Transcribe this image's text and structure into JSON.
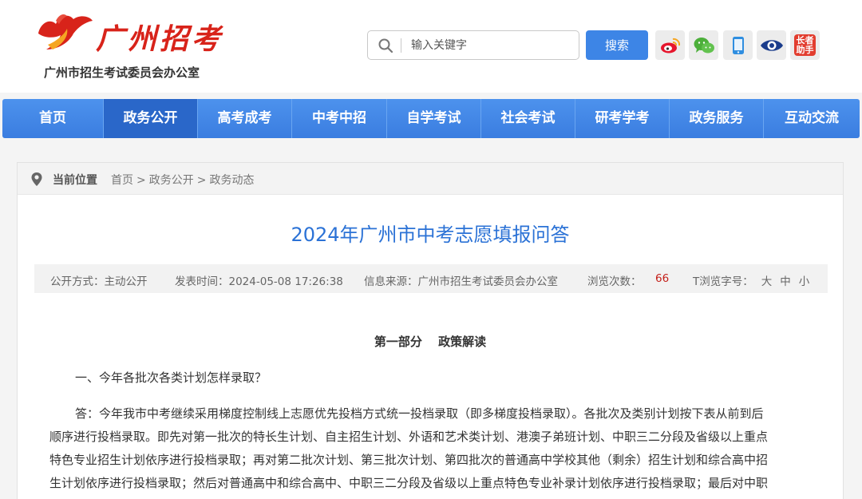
{
  "header": {
    "logo_title": "广州招考",
    "logo_subtitle": "广州市招生考试委员会办公室",
    "search_placeholder": "输入关键字",
    "search_button": "搜索",
    "social_icons": [
      "weibo-icon",
      "wechat-icon",
      "mobile-icon",
      "eye-icon",
      "elder-assistant-icon"
    ],
    "elder_label_line1": "长者",
    "elder_label_line2": "助手"
  },
  "nav": {
    "items": [
      "首页",
      "政务公开",
      "高考成考",
      "中考中招",
      "自学考试",
      "社会考试",
      "研考学考",
      "政务服务",
      "互动交流"
    ],
    "active_index": 1
  },
  "breadcrumb": {
    "label": "当前位置",
    "items": [
      "首页",
      "政务公开",
      "政务动态"
    ],
    "separator": ">"
  },
  "article": {
    "title": "2024年广州市中考志愿填报问答",
    "meta": {
      "disclosure": "公开方式：主动公开",
      "published": "发表时间：2024-05-08 17:26:38",
      "source": "信息来源：广州市招生考试委员会办公室",
      "views_label": "浏览次数：",
      "views": "66",
      "font_size_label": "T浏览字号：",
      "font_sizes": [
        "大",
        "中",
        "小"
      ]
    },
    "section_heading": "第一部分　 政策解读",
    "question": "一、今年各批次各类计划怎样录取？",
    "answer_lines": [
      "答：今年我市中考继续采用梯度控制线上志愿优先投档方式统一投档录取（即多梯度投档录取）。各批次及类别计划按下表从前到后",
      "顺序进行投档录取。即先对第一批次的特长生计划、自主招生计划、外语和艺术类计划、港澳子弟班计划、中职三二分段及省级以上重点",
      "特色专业招生计划依序进行投档录取；再对第二批次计划、第三批次计划、第四批次的普通高中学校其他（剩余）招生计划和综合高中招",
      "生计划依序进行投档录取；然后对普通高中和综合高中、中职三二分段及省级以上重点特色专业补录计划依序进行投档录取；最后对中职"
    ]
  },
  "colors": {
    "nav_blue": "#3d85e6",
    "nav_active": "#2a67c9",
    "title_blue": "#2b72d6",
    "views_red": "#c4201a",
    "logo_red": "#d8231a"
  }
}
